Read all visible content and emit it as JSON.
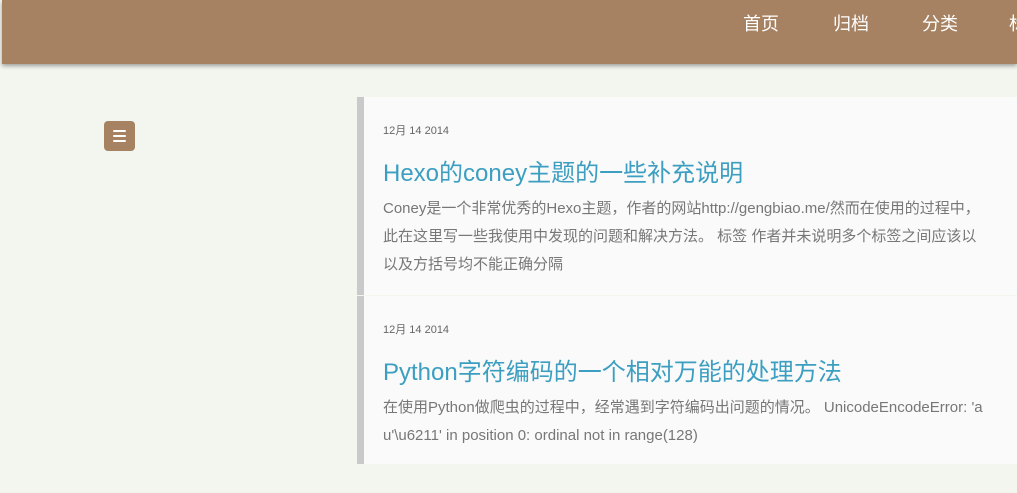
{
  "nav": {
    "items": [
      {
        "label": "首页"
      },
      {
        "label": "归档"
      },
      {
        "label": "分类"
      },
      {
        "label": "标"
      }
    ]
  },
  "sidebar": {
    "menu_icon": "hamburger-menu-icon"
  },
  "posts": [
    {
      "date": "12月 14 2014",
      "title": "Hexo的coney主题的一些补充说明",
      "excerpt_lines": [
        "Coney是一个非常优秀的Hexo主题，作者的网站http://gengbiao.me/然而在使用的过程中，",
        "此在这里写一些我使用中发现的问题和解决方法。 标签 作者并未说明多个标签之间应该以",
        "以及方括号均不能正确分隔"
      ]
    },
    {
      "date": "12月 14 2014",
      "title": "Python字符编码的一个相对万能的处理方法",
      "excerpt_lines": [
        "在使用Python做爬虫的过程中，经常遇到字符编码出问题的情况。 UnicodeEncodeError: 'a",
        "u'\\u6211' in position 0: ordinal not in range(128)"
      ]
    }
  ],
  "colors": {
    "header": "#a68263",
    "page_background": "#f3f6ef",
    "post_background": "#fafafa",
    "post_border": "#c9c9c9",
    "title": "#3c9fc1",
    "excerpt": "#777777"
  }
}
